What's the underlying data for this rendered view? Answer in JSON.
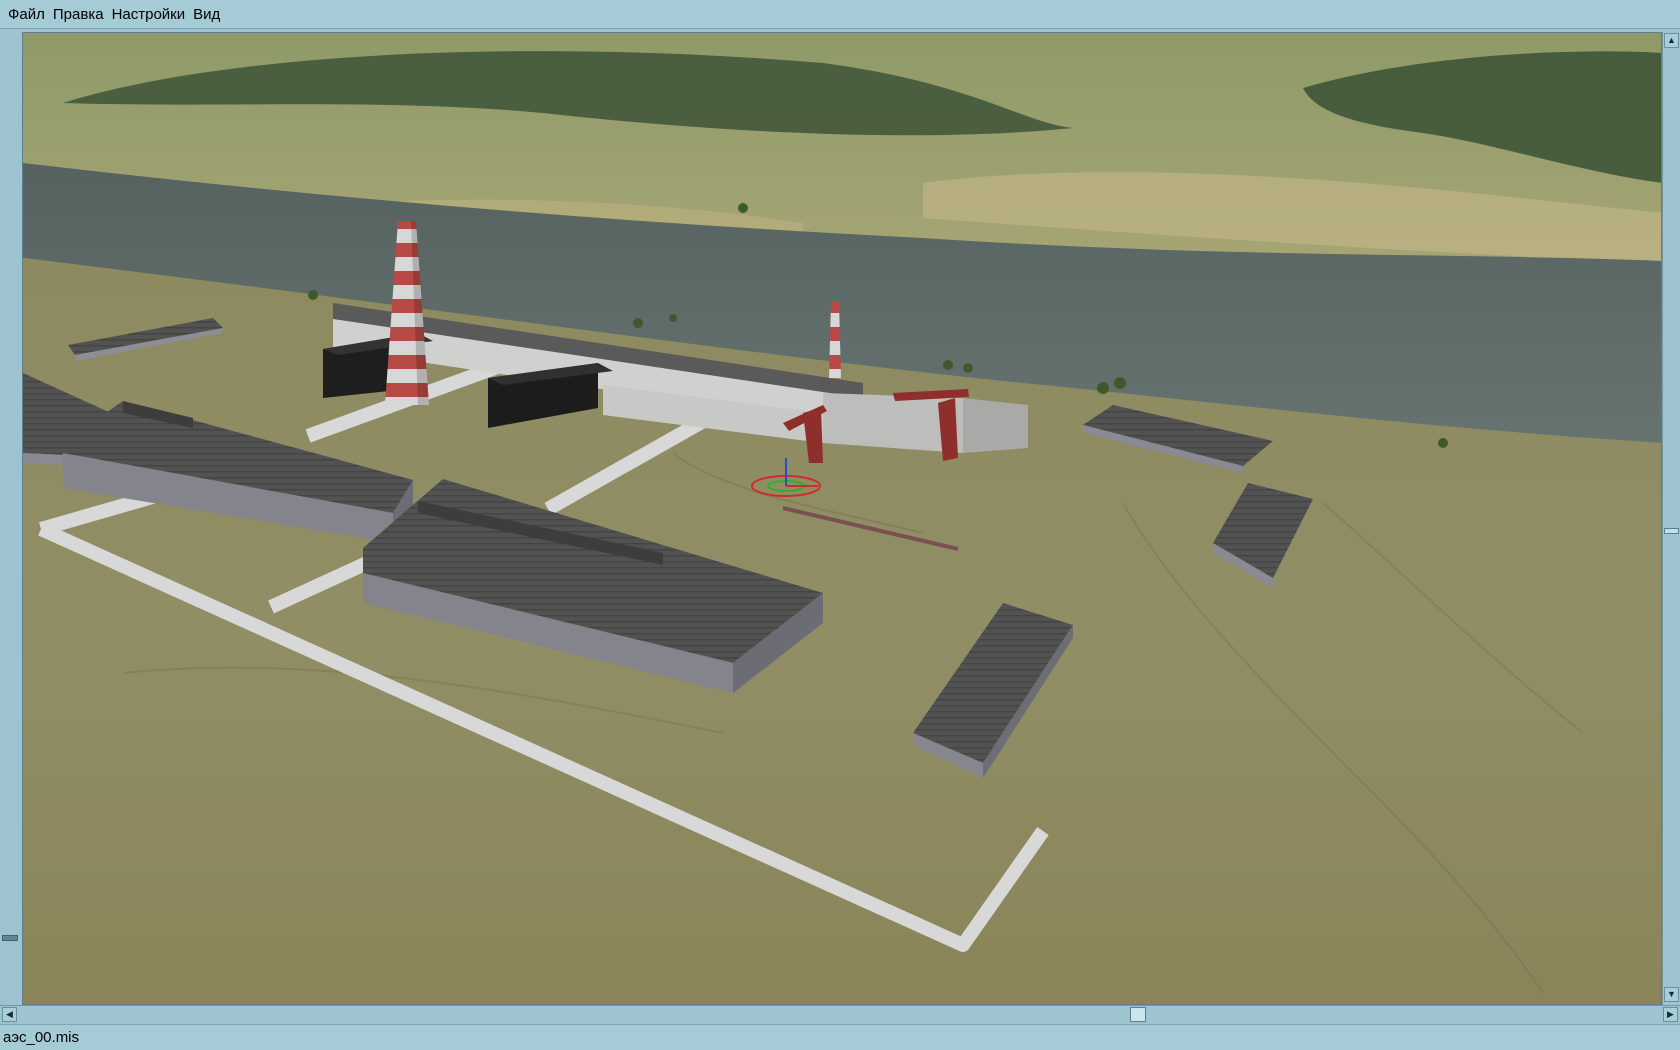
{
  "menu": {
    "items": [
      {
        "label": "Файл"
      },
      {
        "label": "Правка"
      },
      {
        "label": "Настройки"
      },
      {
        "label": "Вид"
      }
    ]
  },
  "status": {
    "filename": "аэс_00.mis"
  },
  "scene": {
    "description_icon": "3d-terrain-viewport"
  },
  "colors": {
    "chrome": "#a5cbd6",
    "water": "#5b6663",
    "ground": "#8b8a5e",
    "roofs": "#4d4d4d",
    "walkway": "#d5d5d5",
    "cranes": "#8c2f2c"
  },
  "scrollbars": {
    "up_icon": "arrow-up-icon",
    "down_icon": "arrow-down-icon",
    "left_icon": "arrow-left-icon",
    "right_icon": "arrow-right-icon"
  }
}
